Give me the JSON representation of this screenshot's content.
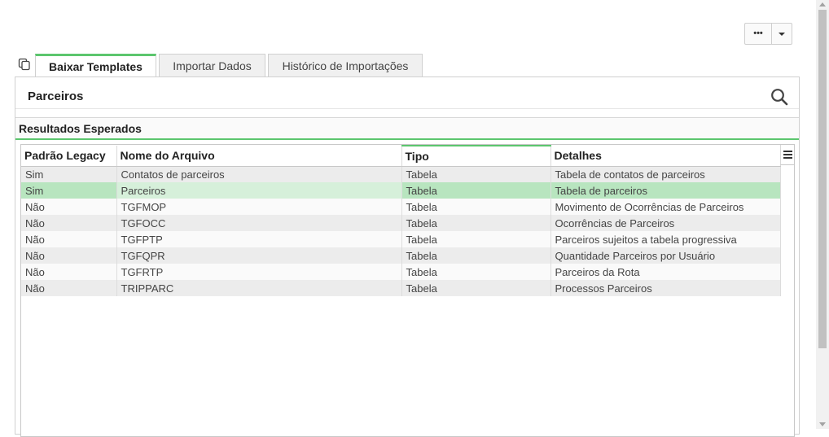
{
  "toolbar": {
    "more_icon": "ellipsis-icon",
    "dropdown_icon": "caret-down-icon"
  },
  "tabs": [
    {
      "label": "Baixar Templates",
      "active": true
    },
    {
      "label": "Importar Dados",
      "active": false
    },
    {
      "label": "Histórico de Importações",
      "active": false
    }
  ],
  "panel": {
    "title": "Parceiros",
    "search_icon": "search-icon"
  },
  "section": {
    "title": "Resultados Esperados"
  },
  "grid": {
    "columns": [
      "Padrão Legacy",
      "Nome do Arquivo",
      "Tipo",
      "Detalhes"
    ],
    "rows": [
      [
        "Sim",
        "Contatos de parceiros",
        "Tabela",
        "Tabela de contatos de parceiros"
      ],
      [
        "Sim",
        "Parceiros",
        "Tabela",
        "Tabela de parceiros"
      ],
      [
        "Não",
        "TGFMOP",
        "Tabela",
        "Movimento de Ocorrências de Parceiros"
      ],
      [
        "Não",
        "TGFOCC",
        "Tabela",
        "Ocorrências de Parceiros"
      ],
      [
        "Não",
        "TGFPTP",
        "Tabela",
        "Parceiros sujeitos a tabela progressiva"
      ],
      [
        "Não",
        "TGFQPR",
        "Tabela",
        "Quantidade Parceiros por Usuário"
      ],
      [
        "Não",
        "TGFRTP",
        "Tabela",
        "Parceiros da Rota"
      ],
      [
        "Não",
        "TRIPPARC",
        "Tabela",
        "Processos Parceiros"
      ]
    ],
    "selected_row": 1
  },
  "colors": {
    "accent": "#5cc66e",
    "selected_row": "#b8e5bf"
  }
}
